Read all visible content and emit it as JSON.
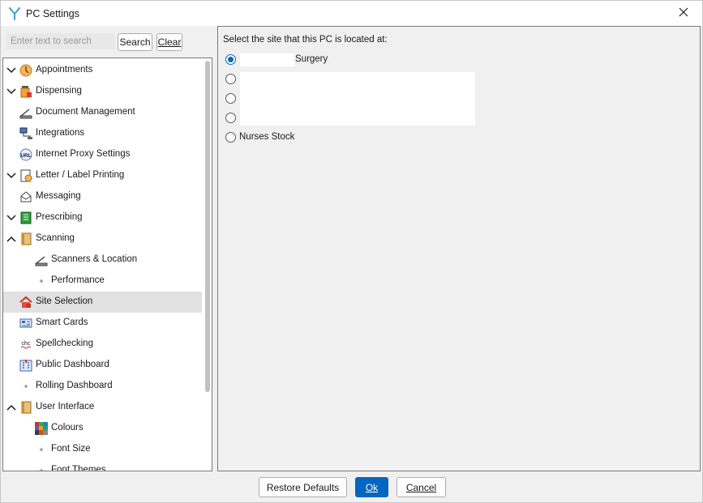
{
  "window": {
    "title": "PC Settings",
    "icon": "app-logo-icon",
    "close_icon": "close-icon"
  },
  "search": {
    "placeholder": "Enter text to search",
    "value": "",
    "search_label": "Search",
    "clear_label": "Clear"
  },
  "tree": {
    "items": [
      {
        "label": "Appointments",
        "expander": "expanded",
        "icon": "clock-icon"
      },
      {
        "label": "Dispensing",
        "expander": "expanded",
        "icon": "pill-bottle-icon"
      },
      {
        "label": "Document Management",
        "expander": "none",
        "icon": "scanner-icon"
      },
      {
        "label": "Integrations",
        "expander": "none",
        "icon": "network-icon"
      },
      {
        "label": "Internet Proxy Settings",
        "expander": "none",
        "icon": "url-icon"
      },
      {
        "label": "Letter / Label Printing",
        "expander": "expanded",
        "icon": "letter-icon"
      },
      {
        "label": "Messaging",
        "expander": "none",
        "icon": "messaging-icon"
      },
      {
        "label": "Prescribing",
        "expander": "expanded",
        "icon": "prescription-icon"
      },
      {
        "label": "Scanning",
        "expander": "collapsed",
        "icon": "book-icon"
      },
      {
        "label": "Scanners & Location",
        "expander": "none",
        "icon": "scanner-icon"
      },
      {
        "label": "Performance",
        "expander": "none",
        "icon": "sparkle-icon"
      },
      {
        "label": "Site Selection",
        "expander": "none",
        "icon": "house-icon",
        "selected": true
      },
      {
        "label": "Smart Cards",
        "expander": "none",
        "icon": "smart-card-icon"
      },
      {
        "label": "Spellchecking",
        "expander": "none",
        "icon": "spellcheck-icon"
      },
      {
        "label": "Public Dashboard",
        "expander": "none",
        "icon": "building-icon"
      },
      {
        "label": "Rolling Dashboard",
        "expander": "none",
        "icon": "sparkle-icon"
      },
      {
        "label": "User Interface",
        "expander": "collapsed",
        "icon": "book-icon"
      },
      {
        "label": "Colours",
        "expander": "none",
        "icon": "palette-grid-icon"
      },
      {
        "label": "Font Size",
        "expander": "none",
        "icon": "sparkle-icon"
      },
      {
        "label": "Font Themes",
        "expander": "none",
        "icon": "sparkle-icon"
      }
    ]
  },
  "site_panel": {
    "heading": "Select the site that this PC is located at:",
    "options": [
      {
        "label": "Surgery",
        "checked": true
      },
      {
        "label": "",
        "checked": false
      },
      {
        "label": "",
        "checked": false
      },
      {
        "label": "",
        "checked": false
      },
      {
        "label": "Nurses Stock",
        "checked": false
      }
    ]
  },
  "footer": {
    "restore_label": "Restore Defaults",
    "ok_label": "Ok",
    "cancel_label": "Cancel"
  },
  "colors": {
    "accent": "#0067c0",
    "selection": "#e1e1e1",
    "panel_bg": "#f0f0f0"
  }
}
